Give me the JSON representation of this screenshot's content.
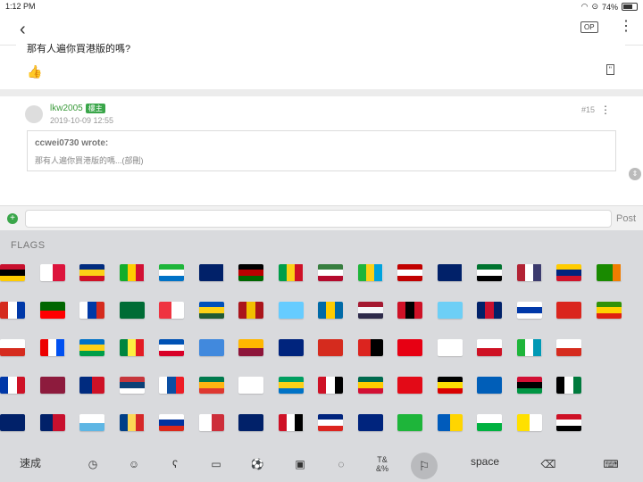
{
  "status": {
    "time": "1:12 PM",
    "battery": "74%",
    "battery_level": 0.74
  },
  "nav": {
    "back": "‹",
    "op": "OP",
    "more": "⋮"
  },
  "post1": {
    "text": "那有人遍你買港版的嗎?"
  },
  "post2": {
    "user": "lkw2005",
    "badge": "樓主",
    "date": "2019-10-09 12:55",
    "floor": "#15",
    "quote_author": "ccwei0730 wrote:",
    "quote_text": "那有人遍你買港版的嗎...(部刪)"
  },
  "input": {
    "post_label": "Post",
    "plus": "+"
  },
  "keyboard": {
    "section": "FLAGS",
    "toolbar": {
      "quick": "速成",
      "space": "space",
      "symbols": "T&\n&%"
    },
    "rows": [
      [
        [
          "#c8102e",
          "#000000",
          "#ffcc00"
        ],
        [
          "#ffffff",
          "#dc143c"
        ],
        [
          "#002b7f",
          "#fcd116",
          "#ce1126"
        ],
        [
          "#12ad2b",
          "#ffce00",
          "#d21034"
        ],
        [
          "#1eb53a",
          "#ffffff",
          "#0072c6"
        ],
        [
          "#012169",
          "#012169",
          "#012169"
        ],
        [
          "#000000",
          "#bb0000",
          "#006600"
        ],
        [
          "#009e49",
          "#fcd116",
          "#ce1126"
        ],
        [
          "#377e3f",
          "#ffffff",
          "#b40a2d"
        ],
        [
          "#1eb53a",
          "#fcd116",
          "#00a3dd"
        ],
        [
          "#c10000",
          "#ffffff",
          "#c10000"
        ],
        [
          "#012169",
          "#012169",
          "#012169"
        ],
        [
          "#00732f",
          "#ffffff",
          "#000000"
        ],
        [
          "#b22234",
          "#ffffff",
          "#3c3b6e"
        ],
        [
          "#ffcc00",
          "#00247d",
          "#cf142b"
        ],
        [
          "#198a00",
          "#198a00",
          "#ef7d00"
        ]
      ],
      [
        [
          "#d52b1e",
          "#ffffff",
          "#0038a8"
        ],
        [
          "#006600",
          "#ff0000"
        ],
        [
          "#ffffff",
          "#0039a6",
          "#d52b1e"
        ],
        [
          "#006c35",
          "#006c35"
        ],
        [
          "#ef3340",
          "#ffffff"
        ],
        [
          "#0051ba",
          "#fcd116",
          "#215b33"
        ],
        [
          "#aa151b",
          "#f1bf00",
          "#aa151b"
        ],
        [
          "#66ccff",
          "#66ccff"
        ],
        [
          "#006aa7",
          "#fecc00",
          "#006aa7"
        ],
        [
          "#a51931",
          "#f4f5f8",
          "#2d2a4a"
        ],
        [
          "#ce1126",
          "#000000",
          "#ce1126"
        ],
        [
          "#6dcff6",
          "#6dcff6"
        ],
        [
          "#012169",
          "#c8102e",
          "#012169"
        ],
        [
          "#ffffff",
          "#0038a8",
          "#ffffff"
        ],
        [
          "#da251d",
          "#da251d"
        ],
        [
          "#319208",
          "#ffd200",
          "#de2010"
        ]
      ],
      [
        [
          "#ffffff",
          "#d52b1e"
        ],
        [
          "#ed0000",
          "#ffffff",
          "#0050f0"
        ],
        [
          "#0072c6",
          "#fcd116",
          "#009e49"
        ],
        [
          "#00853f",
          "#fdef42",
          "#e31b23"
        ],
        [
          "#0052b4",
          "#ffffff",
          "#d80027"
        ],
        [
          "#4189dd",
          "#4189dd"
        ],
        [
          "#ffb700",
          "#8d153a"
        ],
        [
          "#00247d",
          "#00247d"
        ],
        [
          "#d52b1e",
          "#d52b1e"
        ],
        [
          "#dc241f",
          "#000000"
        ],
        [
          "#e70013",
          "#e70013"
        ],
        [
          "#ffffff",
          "#ffffff"
        ],
        [
          "#ffffff",
          "#ce1124"
        ],
        [
          "#1eb53a",
          "#ffffff",
          "#0099b5"
        ],
        [
          "#ffffff",
          "#d52b1e"
        ]
      ],
      [
        [
          "#0038a8",
          "#ffffff",
          "#ce1126"
        ],
        [
          "#8d1b3d",
          "#8d1b3d"
        ],
        [
          "#002b7f",
          "#ce1126"
        ],
        [
          "#c6363c",
          "#0c4076",
          "#ffffff"
        ],
        [
          "#ffffff",
          "#0b4ea2",
          "#ee1c25"
        ],
        [
          "#007a4d",
          "#ffb612",
          "#de3831"
        ],
        [
          "#ffffff",
          "#ffffff"
        ],
        [
          "#009e60",
          "#fcd116",
          "#0072c6"
        ],
        [
          "#ce1126",
          "#ffffff",
          "#000000"
        ],
        [
          "#006a4e",
          "#ffce00",
          "#d21034"
        ],
        [
          "#e30a17",
          "#e30a17"
        ],
        [
          "#000000",
          "#fcdc04",
          "#d90000"
        ],
        [
          "#005eb8",
          "#005eb8"
        ],
        [
          "#d21034",
          "#000000",
          "#009543"
        ],
        [
          "#000000",
          "#ffffff",
          "#007a3d"
        ]
      ],
      [
        [
          "#012169",
          "#012169"
        ],
        [
          "#012169",
          "#c8102e"
        ],
        [
          "#ffffff",
          "#5eb6e4"
        ],
        [
          "#003f87",
          "#fcd856",
          "#d62828"
        ],
        [
          "#ffffff",
          "#0033a0",
          "#da291c"
        ],
        [
          "#ffffff",
          "#cd2e3a"
        ],
        [
          "#012169",
          "#012169"
        ],
        [
          "#ce1126",
          "#ffffff",
          "#000000"
        ],
        [
          "#00247d",
          "#ffffff",
          "#dc241f"
        ],
        [
          "#00247d",
          "#00247d"
        ],
        [
          "#1eb53a",
          "#1eb53a"
        ],
        [
          "#005bbb",
          "#ffd500"
        ],
        [
          "#ffffff",
          "#00b140"
        ],
        [
          "#ffe000",
          "#ffffff"
        ],
        [
          "#ce1126",
          "#ffffff",
          "#000000"
        ]
      ]
    ]
  }
}
